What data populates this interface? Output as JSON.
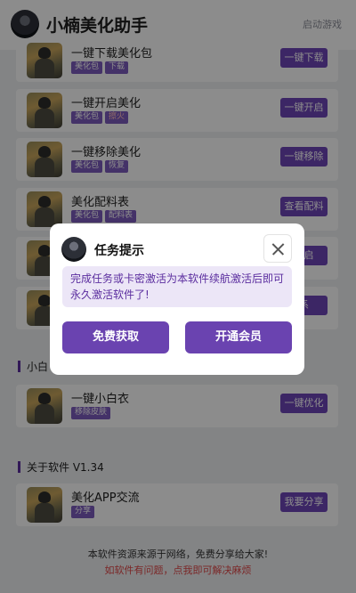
{
  "header": {
    "title": "小楠美化助手",
    "launch_label": "启动游戏"
  },
  "feature_cards": [
    {
      "title": "一键下载美化包",
      "tags": [
        "美化包",
        "下载"
      ],
      "action": "一键下载"
    },
    {
      "title": "一键开启美化",
      "tags": [
        "美化包",
        "擦火"
      ],
      "action": "一键开启"
    },
    {
      "title": "一键移除美化",
      "tags": [
        "美化包",
        "恢复"
      ],
      "action": "一键移除"
    },
    {
      "title": "美化配料表",
      "tags": [
        "美化包",
        "配料表"
      ],
      "action": "查看配料"
    },
    {
      "title": "",
      "tags": [],
      "action": "开启"
    },
    {
      "title": "",
      "tags": [],
      "action": "系"
    }
  ],
  "sections": {
    "xiaobai": {
      "title": "小白",
      "card": {
        "title": "一键小白衣",
        "tags": [
          "移除皮肤"
        ],
        "action": "一键优化"
      }
    },
    "about": {
      "title": "关于软件 V1.34",
      "card": {
        "title": "美化APP交流",
        "tags": [
          "分享"
        ],
        "action": "我要分享"
      }
    }
  },
  "footer": {
    "line1": "本软件资源来源于网络，免费分享给大家!",
    "line2": "如软件有问题，点我即可解决麻烦"
  },
  "dialog": {
    "title": "任务提示",
    "message": "完成任务或卡密激活为本软件续航激活后即可永久激活软件了!",
    "free_button": "免费获取",
    "vip_button": "开通会员"
  },
  "colors": {
    "accent": "#6e45b8",
    "warning_text": "#e04848"
  }
}
